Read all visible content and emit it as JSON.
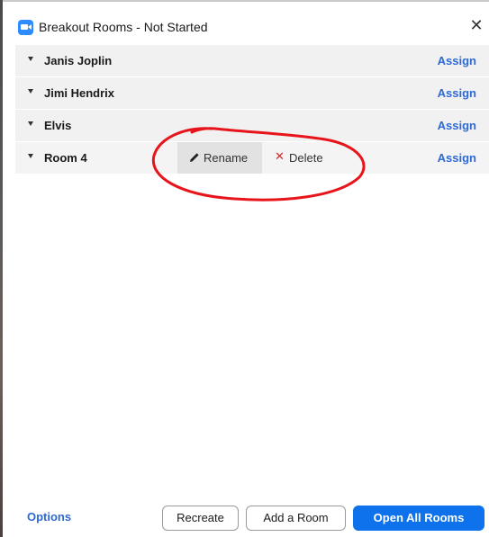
{
  "window": {
    "title": "Breakout Rooms - Not Started",
    "close_glyph": "✕",
    "icon": "zoom-camera-icon"
  },
  "rooms": [
    {
      "name": "Janis Joplin",
      "assign_label": "Assign"
    },
    {
      "name": "Jimi Hendrix",
      "assign_label": "Assign"
    },
    {
      "name": "Elvis",
      "assign_label": "Assign"
    },
    {
      "name": "Room 4",
      "assign_label": "Assign"
    }
  ],
  "room_actions": {
    "rename_label": "Rename",
    "delete_label": "Delete",
    "delete_glyph": "✕"
  },
  "footer": {
    "options_label": "Options",
    "recreate_label": "Recreate",
    "add_room_label": "Add a Room",
    "open_all_label": "Open All Rooms"
  },
  "colors": {
    "accent": "#0e72ed",
    "link": "#2d6ad6",
    "delete": "#e02020",
    "annotation": "#e8141c"
  }
}
